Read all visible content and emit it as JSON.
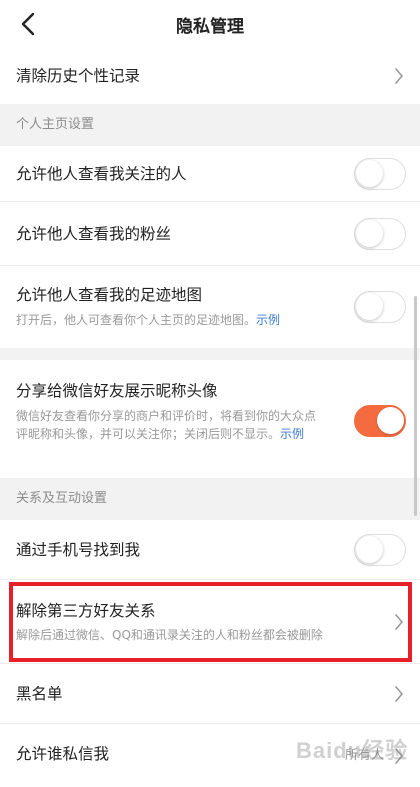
{
  "nav": {
    "title": "隐私管理"
  },
  "history": {
    "label": "清除历史个性记录"
  },
  "sections": {
    "profile": "个人主页设置",
    "relations": "关系及互动设置"
  },
  "rows": {
    "allow_following": {
      "label": "允许他人查看我关注的人",
      "on": false
    },
    "allow_fans": {
      "label": "允许他人查看我的粉丝",
      "on": false
    },
    "allow_footprint": {
      "label": "允许他人查看我的足迹地图",
      "desc": "打开后，他人可查看你个人主页的足迹地图。",
      "link": "示例",
      "on": false
    },
    "share_wechat": {
      "label": "分享给微信好友展示昵称头像",
      "desc": "微信好友查看你分享的商户和评价时，将看到你的大众点评昵称和头像，并可以关注你；关闭后则不显示。",
      "link": "示例",
      "on": true
    },
    "find_by_phone": {
      "label": "通过手机号找到我",
      "on": false
    },
    "unbind_third_party": {
      "label": "解除第三方好友关系",
      "desc": "解除后通过微信、QQ和通讯录关注的人和粉丝都会被删除"
    },
    "blacklist": {
      "label": "黑名单"
    },
    "who_can_message": {
      "label": "允许谁私信我",
      "value": "所有人"
    }
  },
  "watermark": "Baidu经验",
  "colors": {
    "accent": "#f36b3f",
    "highlight": "#e8202a",
    "link": "#3b7bd6"
  },
  "icons": {
    "back": "chevron-left-icon",
    "more": "chevron-right-icon"
  }
}
